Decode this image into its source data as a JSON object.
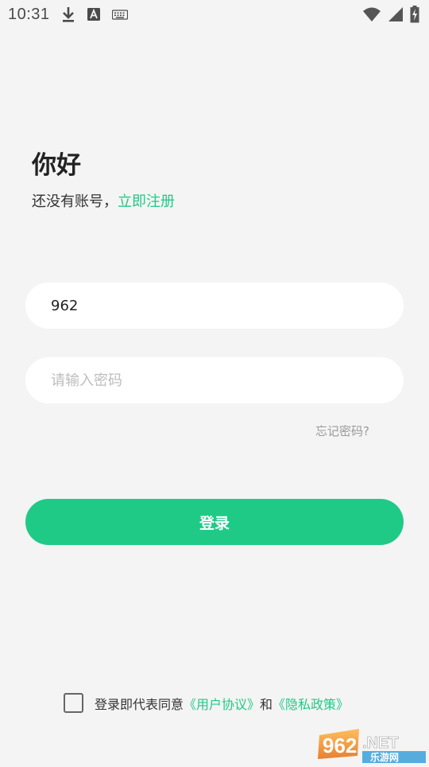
{
  "status_bar": {
    "time": "10:31",
    "left_icons": [
      "download-icon",
      "font-a-icon",
      "keyboard-icon"
    ],
    "right_icons": [
      "wifi-icon",
      "cell-signal-icon",
      "battery-charging-icon"
    ]
  },
  "header": {
    "greeting": "你好",
    "prompt": "还没有账号，",
    "register_link": "立即注册"
  },
  "form": {
    "account_value": "962",
    "password_placeholder": "请输入密码",
    "forgot_label": "忘记密码?",
    "login_label": "登录"
  },
  "agreement": {
    "checked": false,
    "prefix": "登录即代表同意",
    "user_agreement": "《用户协议》",
    "and": "和",
    "privacy_policy": "《隐私政策》"
  },
  "watermark": {
    "brand_number": "962",
    "brand_suffix": ".NET",
    "brand_cn": "乐游网"
  },
  "colors": {
    "accent": "#1fca87",
    "background": "#f4f4f4",
    "field_bg": "#ffffff"
  }
}
